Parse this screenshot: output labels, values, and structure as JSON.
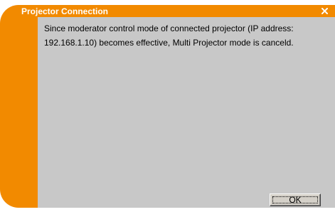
{
  "window": {
    "title": "Projector Connection",
    "close_icon": "close-x-icon"
  },
  "message": {
    "text": "Since moderator control mode of connected projector (IP address: 192.168.1.10) becomes effective, Multi Projector mode is canceld."
  },
  "buttons": {
    "ok_label": "OK"
  },
  "colors": {
    "accent": "#f28a00",
    "content_bg": "#c8c8c8",
    "button_face": "#d4d0c8"
  }
}
